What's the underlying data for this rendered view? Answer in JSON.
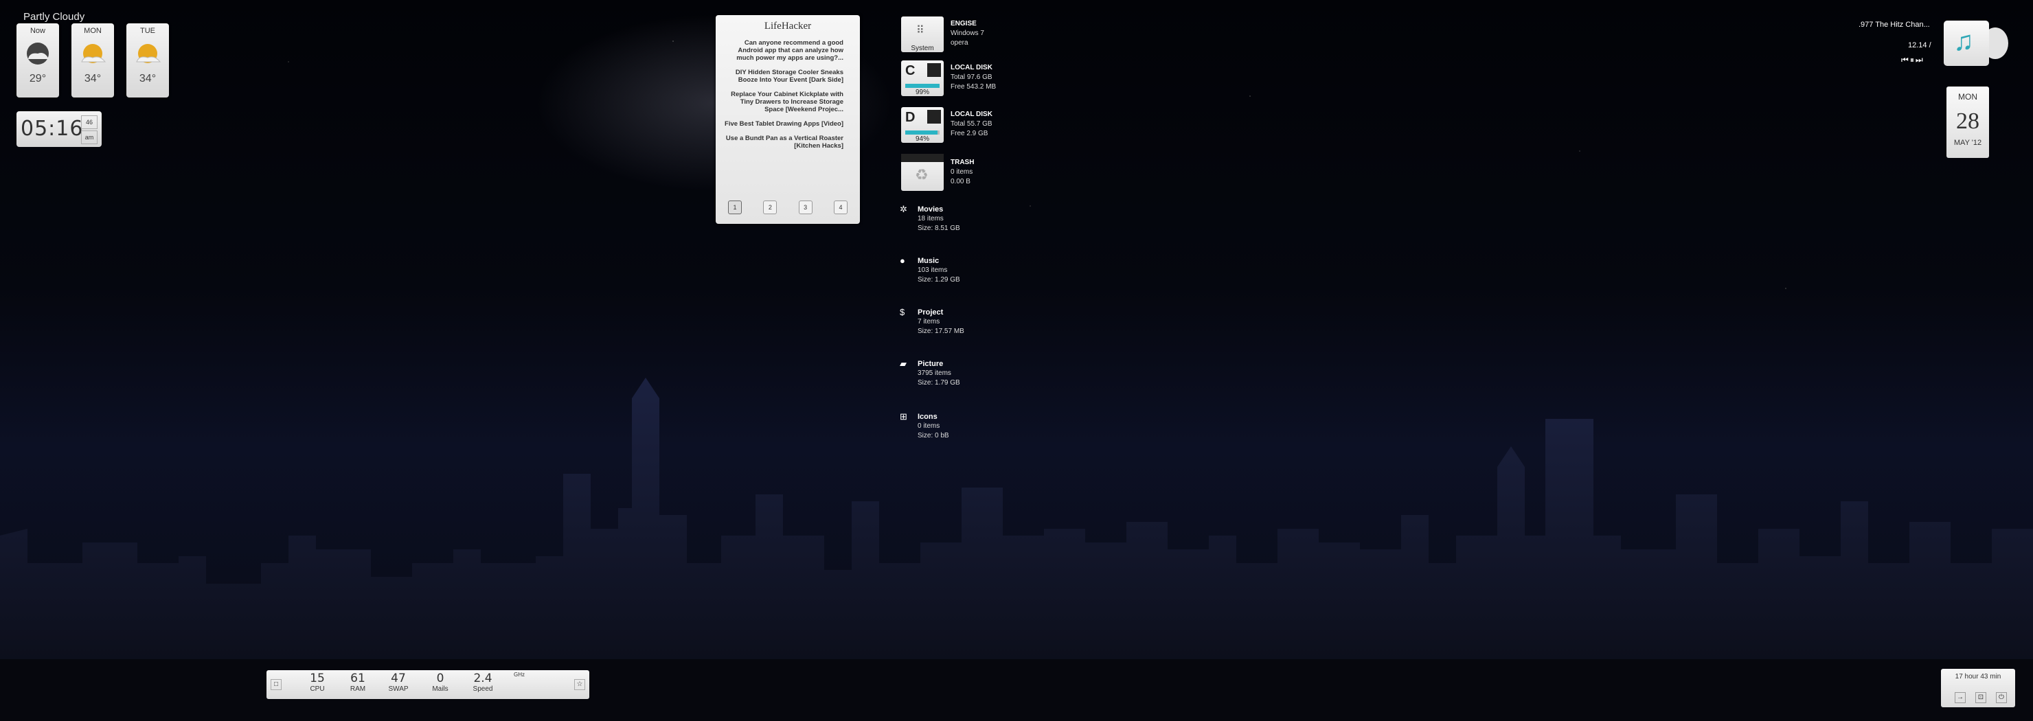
{
  "weather": {
    "condition": "Partly Cloudy",
    "cards": [
      {
        "day": "Now",
        "temp": "29°"
      },
      {
        "day": "MON",
        "temp": "34°"
      },
      {
        "day": "TUE",
        "temp": "34°"
      }
    ]
  },
  "clock": {
    "time": "05:16",
    "seconds": "46",
    "ampm": "am"
  },
  "lifehacker": {
    "title": "LifeHacker",
    "items": [
      "Can anyone recommend a good Android app that can analyze how much power my apps are using?...",
      "DIY Hidden Storage Cooler Sneaks Booze Into Your Event [Dark Side]",
      "Replace Your Cabinet Kickplate with Tiny Drawers to Increase Storage Space [Weekend Projec...",
      "Five Best Tablet Drawing Apps [Video]",
      "Use a Bundt Pan as a Vertical Roaster [Kitchen Hacks]"
    ],
    "pages": [
      "1",
      "2",
      "3",
      "4"
    ]
  },
  "system_info": {
    "icon_label": "System",
    "name": "ENGISE",
    "os": "Windows 7",
    "browser": "opera"
  },
  "drives": [
    {
      "letter": "C",
      "name": "LOCAL DISK",
      "total": "Total 97.6 GB",
      "free": "Free 543.2 MB",
      "percent_label": "99%",
      "percent": 99
    },
    {
      "letter": "D",
      "name": "LOCAL DISK",
      "total": "Total 55.7 GB",
      "free": "Free 2.9 GB",
      "percent_label": "94%",
      "percent": 94
    }
  ],
  "trash": {
    "name": "TRASH",
    "items": "0 items",
    "size": "0.00 B"
  },
  "folders": [
    {
      "name": "Movies",
      "icon": "film-icon",
      "items": "18 items",
      "size": "Size: 8.51 GB"
    },
    {
      "name": "Music",
      "icon": "apple-icon",
      "items": "103 items",
      "size": "Size: 1.29 GB"
    },
    {
      "name": "Project",
      "icon": "dollar-icon",
      "items": "7 items",
      "size": "Size: 17.57 MB"
    },
    {
      "name": "Picture",
      "icon": "camera-icon",
      "items": "3795 items",
      "size": "Size: 1.79 GB"
    },
    {
      "name": "Icons",
      "icon": "windows-icon",
      "items": "0 items",
      "size": "Size: 0 bB"
    }
  ],
  "music": {
    "station": ".977 The Hitz Chan...",
    "track_time": "12.14 /",
    "controls": [
      "prev",
      "pause",
      "next"
    ]
  },
  "calendar": {
    "day": "MON",
    "date": "28",
    "month_year": "MAY '12"
  },
  "stats": [
    {
      "value": "15",
      "label": "CPU"
    },
    {
      "value": "61",
      "label": "RAM"
    },
    {
      "value": "47",
      "label": "SWAP"
    },
    {
      "value": "0",
      "label": "Mails"
    },
    {
      "value": "2.4",
      "label": "Speed"
    }
  ],
  "stats_unit": "GHz",
  "uptime": {
    "text": "17 hour 43 min"
  },
  "colors": {
    "accent": "#2bb4c4",
    "widget_bg": "#eeeeee"
  }
}
